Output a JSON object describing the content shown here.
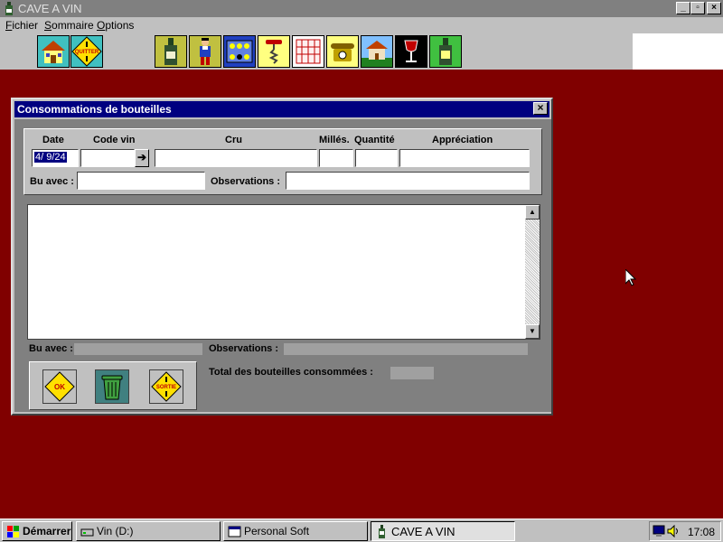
{
  "app": {
    "title": "CAVE A VIN",
    "window_buttons": {
      "minimize": "_",
      "maximize": "▫",
      "close": "×"
    }
  },
  "menu": {
    "items": [
      {
        "label": "Fichier",
        "accel": "F",
        "rest": "ichier"
      },
      {
        "label": "Sommaire",
        "accel": "S",
        "rest": "ommaire"
      },
      {
        "label": "Options",
        "accel": "O",
        "rest": "ptions"
      }
    ]
  },
  "toolbar": {
    "quit_label": "QUITTER",
    "icons": [
      "home-icon",
      "quit-sign-icon",
      "wine-bottle-icon",
      "person-icon",
      "cellar-rack-icon",
      "corkscrew-icon",
      "book-icon",
      "telephone-icon",
      "chateau-icon",
      "wine-glass-icon",
      "bottle-label-icon"
    ]
  },
  "dialog": {
    "title": "Consommations de bouteilles",
    "close_label": "×",
    "labels": {
      "date": "Date",
      "code_vin": "Code vin",
      "cru": "Cru",
      "millesime": "Millés.",
      "quantite": "Quantité",
      "appreciation": "Appréciation",
      "bu_avec": "Bu avec :",
      "observations": "Observations :"
    },
    "values": {
      "date": "4/ 9/24",
      "code_vin": "",
      "cru": "",
      "millesime": "",
      "quantite": "",
      "appreciation": "",
      "bu_avec": "",
      "observations": ""
    },
    "code_arrow": "➔",
    "detail": {
      "bu_avec_label": "Bu avec :",
      "observations_label": "Observations :",
      "total_label": "Total des bouteilles consommées :"
    },
    "buttons": {
      "ok": "OK",
      "sortie": "SORTIE"
    }
  },
  "taskbar": {
    "start": "Démarrer",
    "tasks": [
      {
        "label": "Vin (D:)"
      },
      {
        "label": "Personal Soft"
      },
      {
        "label": "CAVE A VIN"
      }
    ],
    "clock": "17:08"
  },
  "colors": {
    "desktop": "#800000",
    "dialog_title": "#000080",
    "face": "#c0c0c0"
  }
}
